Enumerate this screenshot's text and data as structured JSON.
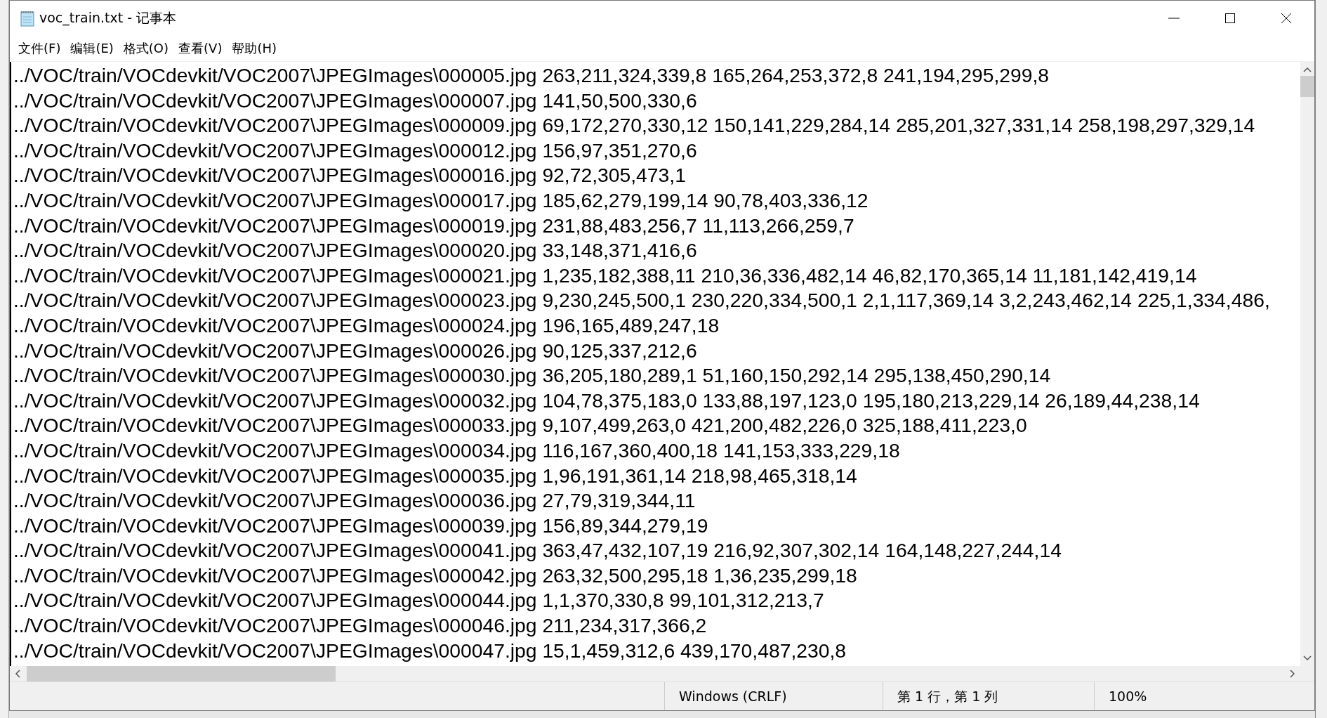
{
  "window": {
    "title": "voc_train.txt - 记事本"
  },
  "menu": [
    "文件(F)",
    "编辑(E)",
    "格式(O)",
    "查看(V)",
    "帮助(H)"
  ],
  "lines": [
    "../VOC/train/VOCdevkit/VOC2007\\JPEGImages\\000005.jpg 263,211,324,339,8 165,264,253,372,8 241,194,295,299,8",
    "../VOC/train/VOCdevkit/VOC2007\\JPEGImages\\000007.jpg 141,50,500,330,6",
    "../VOC/train/VOCdevkit/VOC2007\\JPEGImages\\000009.jpg 69,172,270,330,12 150,141,229,284,14 285,201,327,331,14 258,198,297,329,14",
    "../VOC/train/VOCdevkit/VOC2007\\JPEGImages\\000012.jpg 156,97,351,270,6",
    "../VOC/train/VOCdevkit/VOC2007\\JPEGImages\\000016.jpg 92,72,305,473,1",
    "../VOC/train/VOCdevkit/VOC2007\\JPEGImages\\000017.jpg 185,62,279,199,14 90,78,403,336,12",
    "../VOC/train/VOCdevkit/VOC2007\\JPEGImages\\000019.jpg 231,88,483,256,7 11,113,266,259,7",
    "../VOC/train/VOCdevkit/VOC2007\\JPEGImages\\000020.jpg 33,148,371,416,6",
    "../VOC/train/VOCdevkit/VOC2007\\JPEGImages\\000021.jpg 1,235,182,388,11 210,36,336,482,14 46,82,170,365,14 11,181,142,419,14",
    "../VOC/train/VOCdevkit/VOC2007\\JPEGImages\\000023.jpg 9,230,245,500,1 230,220,334,500,1 2,1,117,369,14 3,2,243,462,14 225,1,334,486,",
    "../VOC/train/VOCdevkit/VOC2007\\JPEGImages\\000024.jpg 196,165,489,247,18",
    "../VOC/train/VOCdevkit/VOC2007\\JPEGImages\\000026.jpg 90,125,337,212,6",
    "../VOC/train/VOCdevkit/VOC2007\\JPEGImages\\000030.jpg 36,205,180,289,1 51,160,150,292,14 295,138,450,290,14",
    "../VOC/train/VOCdevkit/VOC2007\\JPEGImages\\000032.jpg 104,78,375,183,0 133,88,197,123,0 195,180,213,229,14 26,189,44,238,14",
    "../VOC/train/VOCdevkit/VOC2007\\JPEGImages\\000033.jpg 9,107,499,263,0 421,200,482,226,0 325,188,411,223,0",
    "../VOC/train/VOCdevkit/VOC2007\\JPEGImages\\000034.jpg 116,167,360,400,18 141,153,333,229,18",
    "../VOC/train/VOCdevkit/VOC2007\\JPEGImages\\000035.jpg 1,96,191,361,14 218,98,465,318,14",
    "../VOC/train/VOCdevkit/VOC2007\\JPEGImages\\000036.jpg 27,79,319,344,11",
    "../VOC/train/VOCdevkit/VOC2007\\JPEGImages\\000039.jpg 156,89,344,279,19",
    "../VOC/train/VOCdevkit/VOC2007\\JPEGImages\\000041.jpg 363,47,432,107,19 216,92,307,302,14 164,148,227,244,14",
    "../VOC/train/VOCdevkit/VOC2007\\JPEGImages\\000042.jpg 263,32,500,295,18 1,36,235,299,18",
    "../VOC/train/VOCdevkit/VOC2007\\JPEGImages\\000044.jpg 1,1,370,330,8 99,101,312,213,7",
    "../VOC/train/VOCdevkit/VOC2007\\JPEGImages\\000046.jpg 211,234,317,366,2",
    "../VOC/train/VOCdevkit/VOC2007\\JPEGImages\\000047.jpg 15,1,459,312,6 439,170,487,230,8"
  ],
  "status_bar": {
    "line_ending": "Windows (CRLF)",
    "position": "第 1 行，第 1 列",
    "zoom": "100%"
  }
}
